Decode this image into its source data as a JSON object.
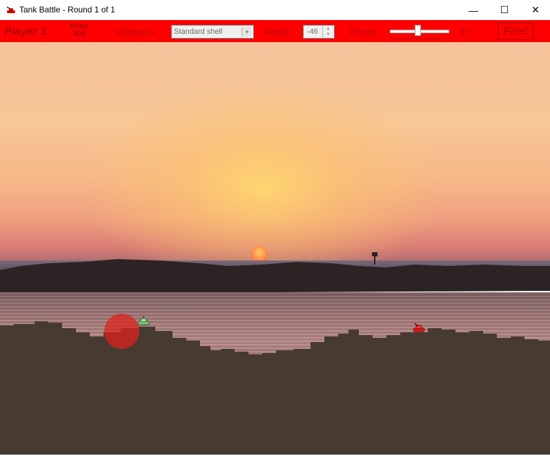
{
  "window": {
    "title": "Tank Battle - Round 1 of 1",
    "app_icon": "red-tank-icon",
    "controls": {
      "minimize": "—",
      "maximize": "☐",
      "close": "✕"
    }
  },
  "toolbar": {
    "player": "Player 1",
    "wind_label": "Wind",
    "wind_value": "30E",
    "weapon_label": "Weapon:",
    "weapon_selected": "Standard shell",
    "angle_label": "Angle:",
    "angle_value": "-46",
    "power_label": "Power:",
    "power_value": "47",
    "power_fraction": 0.47,
    "fire_label": "Fire!",
    "color": "#ff0000"
  },
  "game": {
    "tanks": [
      {
        "id": "player-1",
        "color": "#7fc97a"
      },
      {
        "id": "player-2",
        "color": "#e01c1c"
      }
    ],
    "terrain_color": "#473a31",
    "crater_color": "#dc231e"
  }
}
